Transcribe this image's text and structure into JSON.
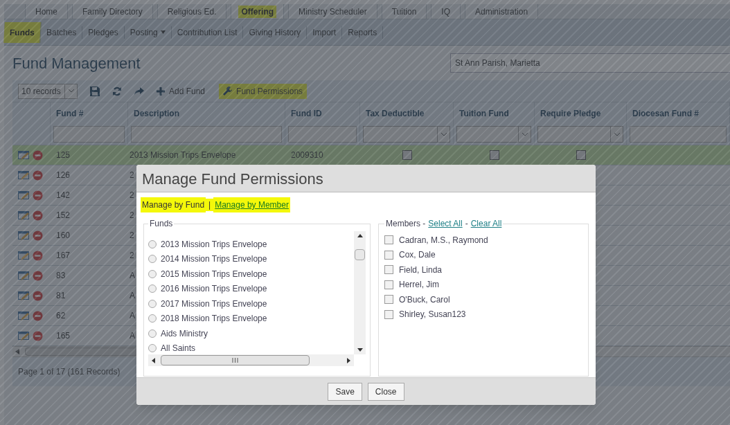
{
  "top_tabs": [
    {
      "label": "Home",
      "selected": false,
      "highlighted": false
    },
    {
      "label": "Family Directory",
      "selected": false,
      "highlighted": false
    },
    {
      "label": "Religious Ed.",
      "selected": false,
      "highlighted": false
    },
    {
      "label": "Offering",
      "selected": true,
      "highlighted": true
    },
    {
      "label": "Ministry Scheduler",
      "selected": false,
      "highlighted": false
    },
    {
      "label": "Tuition",
      "selected": false,
      "highlighted": false
    },
    {
      "label": "IQ",
      "selected": false,
      "highlighted": false
    },
    {
      "label": "Administration",
      "selected": false,
      "highlighted": false
    }
  ],
  "sub_nav": [
    {
      "label": "Funds",
      "selected": true,
      "highlighted": true,
      "dropdown": false
    },
    {
      "label": "Batches",
      "selected": false,
      "highlighted": false,
      "dropdown": false
    },
    {
      "label": "Pledges",
      "selected": false,
      "highlighted": false,
      "dropdown": false
    },
    {
      "label": "Posting",
      "selected": false,
      "highlighted": false,
      "dropdown": true
    },
    {
      "label": "Contribution List",
      "selected": false,
      "highlighted": false,
      "dropdown": false
    },
    {
      "label": "Giving History",
      "selected": false,
      "highlighted": false,
      "dropdown": false
    },
    {
      "label": "Import",
      "selected": false,
      "highlighted": false,
      "dropdown": false
    },
    {
      "label": "Reports",
      "selected": false,
      "highlighted": false,
      "dropdown": false
    }
  ],
  "page_title": "Fund Management",
  "parish_select": {
    "value": "St Ann Parish, Marietta"
  },
  "toolbar": {
    "page_size": "10 records",
    "add_label": "Add Fund",
    "permissions_label": "Fund Permissions",
    "permissions_highlighted": true
  },
  "grid": {
    "columns": [
      {
        "label": "Fund #",
        "kind": "text"
      },
      {
        "label": "Description",
        "kind": "text"
      },
      {
        "label": "Fund ID",
        "kind": "text"
      },
      {
        "label": "Tax Deductible",
        "kind": "select"
      },
      {
        "label": "Tuition Fund",
        "kind": "select"
      },
      {
        "label": "Require Pledge",
        "kind": "select"
      },
      {
        "label": "Diocesan Fund #",
        "kind": "text"
      }
    ],
    "rows": [
      {
        "fund_number": "125",
        "description": "2013 Mission Trips Envelope",
        "fund_id": "2009310",
        "selected": true,
        "tax_deductible": false,
        "tuition_fund": false,
        "require_pledge": false
      },
      {
        "fund_number": "126",
        "description": "2",
        "selected": false
      },
      {
        "fund_number": "142",
        "description": "2",
        "selected": false
      },
      {
        "fund_number": "152",
        "description": "2",
        "selected": false
      },
      {
        "fund_number": "160",
        "description": "2",
        "selected": false
      },
      {
        "fund_number": "167",
        "description": "2",
        "selected": false
      },
      {
        "fund_number": "83",
        "description": "A",
        "selected": false
      },
      {
        "fund_number": "81",
        "description": "A",
        "selected": false
      },
      {
        "fund_number": "62",
        "description": "A",
        "selected": false
      },
      {
        "fund_number": "165",
        "description": "A",
        "selected": false
      }
    ],
    "pager": "Page 1 of 17 (161 Records)"
  },
  "dialog": {
    "title": "Manage Fund Permissions",
    "modes_divider": "|",
    "modes": [
      {
        "label": "Manage by Fund",
        "selected": true,
        "highlighted": true
      },
      {
        "label": "Manage by Member",
        "selected": false,
        "highlighted": true
      }
    ],
    "funds_legend": "Funds",
    "funds": [
      {
        "label": "2013 Mission Trips Envelope",
        "selected": false
      },
      {
        "label": "2014 Mission Trips Envelope",
        "selected": false
      },
      {
        "label": "2015 Mission Trips Envelope",
        "selected": false
      },
      {
        "label": "2016 Mission Trips Envelope",
        "selected": false
      },
      {
        "label": "2017 Mission Trips Envelope",
        "selected": false
      },
      {
        "label": "2018 Mission Trips Envelope",
        "selected": false
      },
      {
        "label": "Aids Ministry",
        "selected": false
      },
      {
        "label": "All Saints",
        "selected": false
      }
    ],
    "members_legend": "Members -",
    "select_all": "Select All",
    "separator": "-",
    "clear_all": "Clear All",
    "members": [
      {
        "name": "Cadran, M.S., Raymond",
        "checked": false
      },
      {
        "name": "Cox, Dale",
        "checked": false
      },
      {
        "name": "Field, Linda",
        "checked": false
      },
      {
        "name": "Herrel, Jim",
        "checked": false
      },
      {
        "name": "O'Buck, Carol",
        "checked": false
      },
      {
        "name": "Shirley, Susan123",
        "checked": false
      }
    ],
    "buttons": [
      "Save",
      "Close"
    ]
  }
}
